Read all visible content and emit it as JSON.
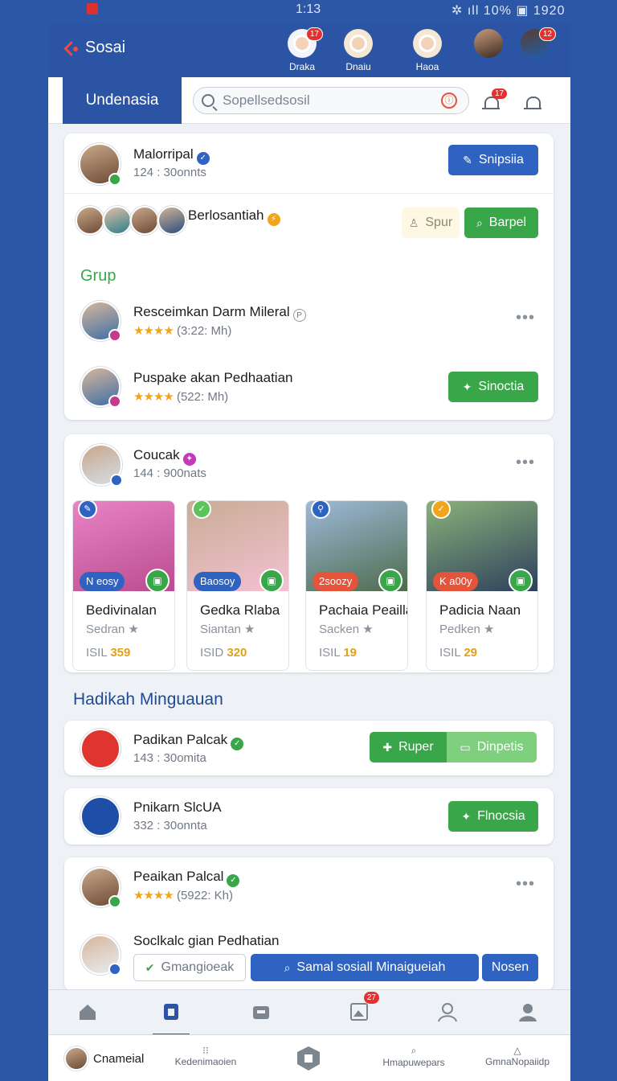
{
  "status": {
    "time": "1:13",
    "right": "✲ ıll 10% ▣ 1920"
  },
  "app": {
    "title": "Sosai",
    "accent": "#2b55a4",
    "green": "#3aa64a"
  },
  "top_nav": [
    {
      "label": "Draka",
      "badge": "17"
    },
    {
      "label": "Dnaiu",
      "badge": ""
    },
    {
      "label": "Haoa",
      "badge": ""
    },
    {
      "label": "",
      "badge": ""
    },
    {
      "label": "",
      "badge": "12"
    }
  ],
  "subbar": {
    "tab": "Undenasia",
    "search_value": "Sopellsedsosil",
    "notif_badge": "17"
  },
  "card1": {
    "profile": {
      "name": "Malorripal",
      "meta": "124 : 30onnts",
      "button": "Snipsiia"
    },
    "group_row": {
      "name": "Berlosantiah",
      "btn1": "Spur",
      "btn2": "Barpel"
    },
    "section": "Grup",
    "items": [
      {
        "name": "Resceimkan Darm Mileral",
        "stars": "★★★★",
        "meta": "(3:22: Mh)"
      },
      {
        "name": "Puspake akan Pedhaatian",
        "stars": "★★★★",
        "meta": "(522: Mh)",
        "button": "Sinoctia"
      }
    ]
  },
  "card2": {
    "name": "Coucak",
    "meta": "144 : 900nats",
    "tiles": [
      {
        "pill": "N eosy",
        "title": "Bedivinalan",
        "sub": "Sedran ★",
        "price_label": "ISIL",
        "price": "359"
      },
      {
        "pill": "Baosoy",
        "title": "Gedka Rlaba",
        "sub": "Siantan ★",
        "price_label": "ISID",
        "price": "320"
      },
      {
        "pill": "2soozy",
        "title": "Pachaia Peailla",
        "sub": "Sacken ★",
        "price_label": "ISIL",
        "price": "19"
      },
      {
        "pill": "K a00y",
        "title": "Padicia Naan",
        "sub": "Pedken ★",
        "price_label": "ISIL",
        "price": "29"
      }
    ]
  },
  "section2": "Hadikah Minguauan",
  "rows": [
    {
      "name": "Padikan Palcak",
      "meta": "143 : 30omita",
      "btn1": "Ruper",
      "btn2": "Dinpetis"
    },
    {
      "name": "Pnikarn SlcUA",
      "meta": "332 : 30onnta",
      "button": "Flnocsia"
    }
  ],
  "card3": {
    "p1": {
      "name": "Peaikan Palcal",
      "stars": "★★★★",
      "meta": "(5922: Kh)"
    },
    "p2": {
      "name": "Soclkalc gian Pedhatian",
      "check_label": "Gmangioeak",
      "search_btn": "Samal sosiall Minaigueiah",
      "btn": "Nosen"
    }
  },
  "bottom_nav": {
    "badge": "27"
  },
  "footer": [
    {
      "label": "Cnameial"
    },
    {
      "label": "Kedenimaoien"
    },
    {
      "label": ""
    },
    {
      "label": "Hmapuwepars"
    },
    {
      "label": "GmnaNopaiidp"
    }
  ]
}
